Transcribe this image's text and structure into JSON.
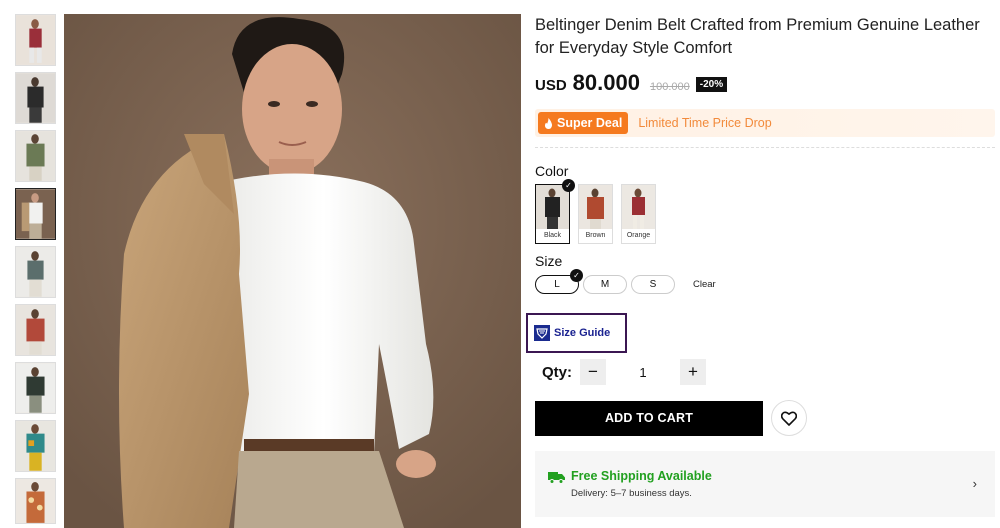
{
  "product": {
    "title": "Beltinger Denim Belt Crafted from Premium Genuine Leather for Everyday Style Comfort",
    "currency": "USD",
    "price": "80.000",
    "old_price": "100.000",
    "discount": "-20%"
  },
  "deal": {
    "badge_label": "Super Deal",
    "text": "Limited Time Price Drop",
    "icon": "flame-icon"
  },
  "color": {
    "label": "Color",
    "options": [
      {
        "name": "Black",
        "selected": true
      },
      {
        "name": "Brown",
        "selected": false
      },
      {
        "name": "Orange",
        "selected": false
      }
    ]
  },
  "size": {
    "label": "Size",
    "options": [
      {
        "name": "L",
        "selected": true
      },
      {
        "name": "M",
        "selected": false
      },
      {
        "name": "S",
        "selected": false
      }
    ],
    "clear_label": "Clear"
  },
  "size_guide": {
    "label": "Size Guide",
    "icon": "ruler-shield-icon"
  },
  "quantity": {
    "label": "Qty:",
    "value": "1",
    "minus": "−",
    "plus": "+"
  },
  "cart": {
    "add_label": "ADD TO CART",
    "wishlist_icon": "heart-icon"
  },
  "shipping": {
    "title": "Free Shipping Available",
    "subtitle": "Delivery: 5–7 business days.",
    "icon": "truck-icon",
    "chevron": "›"
  },
  "colors": {
    "accent_orange": "#f57a1f",
    "shipping_green": "#22a020",
    "size_guide_blue": "#1a2290"
  }
}
